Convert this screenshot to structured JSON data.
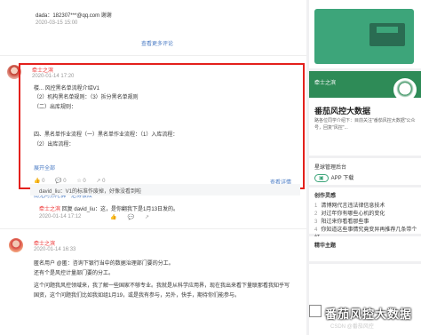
{
  "comments": {
    "top_reply": {
      "line": "dada：182307***@qq.com 谢谢",
      "time": "2020-03-15 15:00"
    },
    "view_more": "查看更多评论",
    "highlighted": {
      "author": "牵士之滨",
      "time": "2020-01-14 17:20",
      "lines": [
        "楼... 风控黑名单流程介绍V1",
        "（2）机构黑名单规则：（3）拆分黑名单规则",
        "（二）出库规则：",
        "四、黑名单作业流程（一）黑名单作业流程：（1）入库流程：",
        "（2）出库流程："
      ],
      "expand": "展开全部",
      "actions": [
        "0",
        "0",
        "0",
        "0"
      ],
      "view_detail": "查看详情",
      "links": [
        "南无阿弥陀佛",
        "范得很炫"
      ],
      "reply_line": "david_liu：V1的标准作废掉，好像没看到啦"
    },
    "second": {
      "author": "牵士之滨",
      "text": "回复 david_liu：这，是你翻我下是1月13日发的。",
      "time": "2020-01-14 17:12"
    },
    "third": {
      "author": "牵士之滨",
      "time": "2020-01-14 16:33",
      "lines": [
        "匿名用户 @匿：咨询下银行当中的数据治理部门要的分工。",
        "还有个是风控计量部门要的分工。",
        "这个问题我风控领域来，我了解一些国家不够专业。我就是从科学应用界，现在我出来看下量联那看我知乎写",
        "国资，这个问题我们比如我如组1月19，或是我有参与，另外，快手，期待你们能参与。"
      ]
    }
  },
  "sidebar": {
    "profile": {
      "name": "牵士之滨",
      "title": "番茄风控大数据",
      "desc": "路各位同学介绍下：目前关注\"番茄风控大数据\"公众号，回复\"风控\"..."
    },
    "tools": {
      "title": "星球管理后台",
      "app": "APP 下载"
    },
    "tags": {
      "title": "创作灵感",
      "items": [
        {
          "n": "1",
          "text": "清博网代言违法律信息技术"
        },
        {
          "n": "2",
          "text": "对过年你有哪些心机的变化"
        },
        {
          "n": "3",
          "text": "阳过来你看看那些事"
        },
        {
          "n": "4",
          "text": "你知道这些事情究竟变异再推荐几条带个好"
        }
      ]
    },
    "ads": {
      "title": "精华主题"
    },
    "watermark": {
      "title": "番茄风控大数据",
      "source": "CSDN @番茄风控"
    }
  }
}
